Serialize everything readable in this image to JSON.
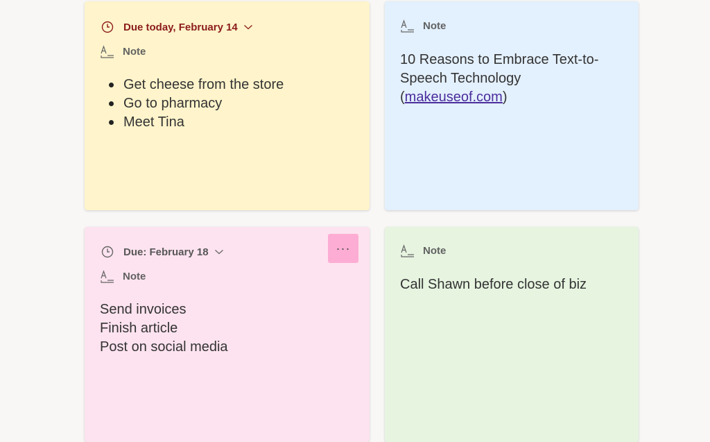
{
  "colors": {
    "background": "#f8f7f6",
    "yellow_card": "#fff4cb",
    "blue_card": "#e3f0fd",
    "pink_card": "#fde3ef",
    "green_card": "#e6f4e0",
    "due_today": "#8c1c1c",
    "link": "#4b2d9c",
    "more_button": "#fdadd3"
  },
  "cards": {
    "yellow": {
      "due_label": "Due today, February 14",
      "type_label": "Note",
      "items": [
        "Get cheese from the store",
        "Go to pharmacy",
        "Meet Tina"
      ]
    },
    "blue": {
      "type_label": "Note",
      "line1": "10 Reasons to Embrace Text-to-",
      "line2": "Speech Technology",
      "paren_open": "(",
      "link_text": "makeuseof.com",
      "paren_close": ")"
    },
    "pink": {
      "due_label": "Due: February 18",
      "type_label": "Note",
      "more_label": "···",
      "lines": [
        "Send invoices",
        "Finish article",
        "Post on social media"
      ]
    },
    "green": {
      "type_label": "Note",
      "text": "Call Shawn before close of biz"
    }
  },
  "icons": {
    "due": "clock-icon",
    "dropdown": "chevron-down-icon",
    "note": "note-icon"
  }
}
